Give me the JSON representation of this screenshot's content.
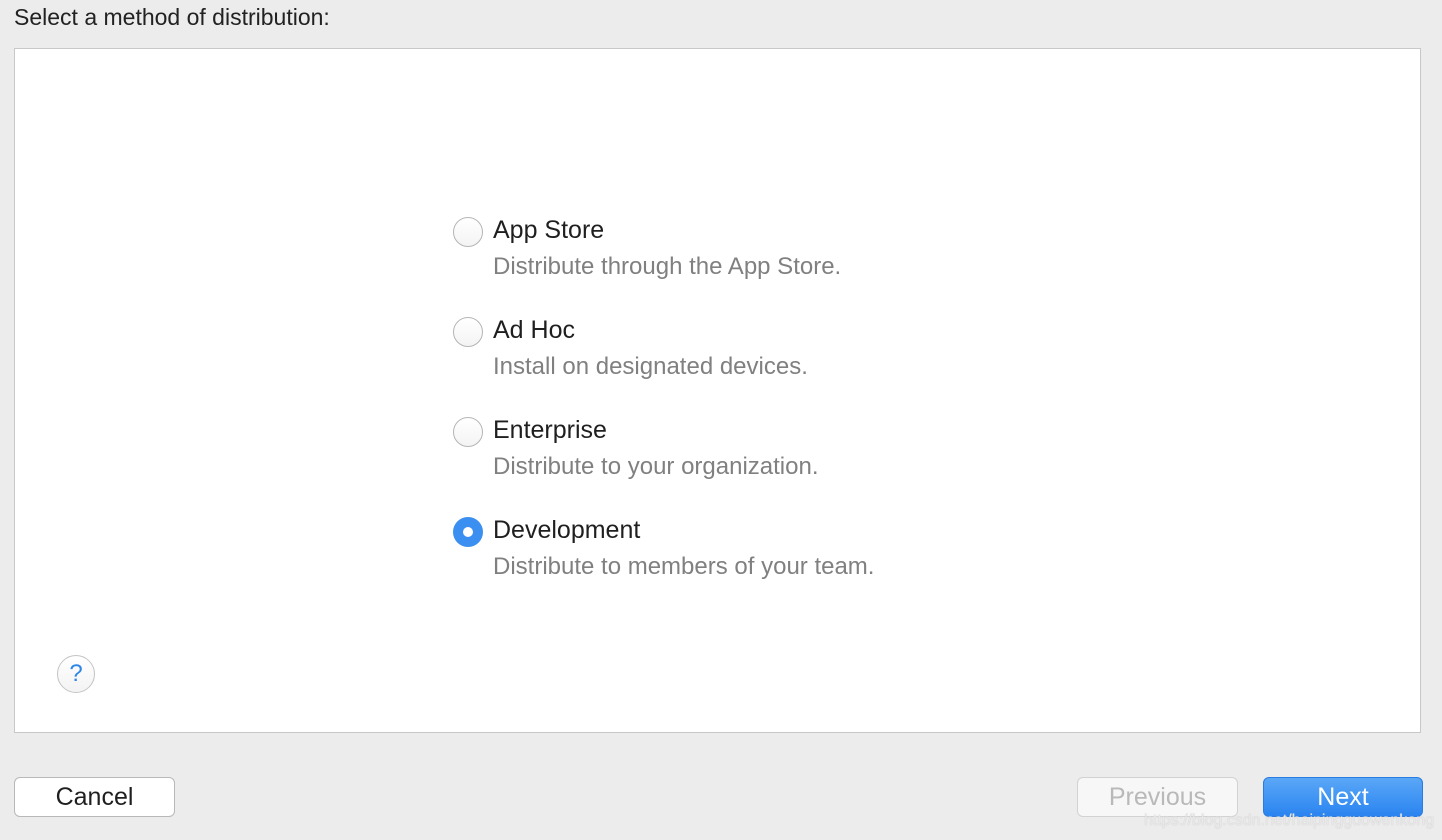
{
  "header": {
    "title": "Select a method of distribution:"
  },
  "options": [
    {
      "label": "App Store",
      "description": "Distribute through the App Store.",
      "selected": false
    },
    {
      "label": "Ad Hoc",
      "description": "Install on designated devices.",
      "selected": false
    },
    {
      "label": "Enterprise",
      "description": "Distribute to your organization.",
      "selected": false
    },
    {
      "label": "Development",
      "description": "Distribute to members of your team.",
      "selected": true
    }
  ],
  "help": {
    "label": "?"
  },
  "footer": {
    "cancel_label": "Cancel",
    "previous_label": "Previous",
    "next_label": "Next"
  },
  "watermark": "https://blog.csdn.net/haipingguowenkong",
  "colors": {
    "accent": "#3a8ff0",
    "background": "#ececec",
    "panel": "#ffffff"
  }
}
